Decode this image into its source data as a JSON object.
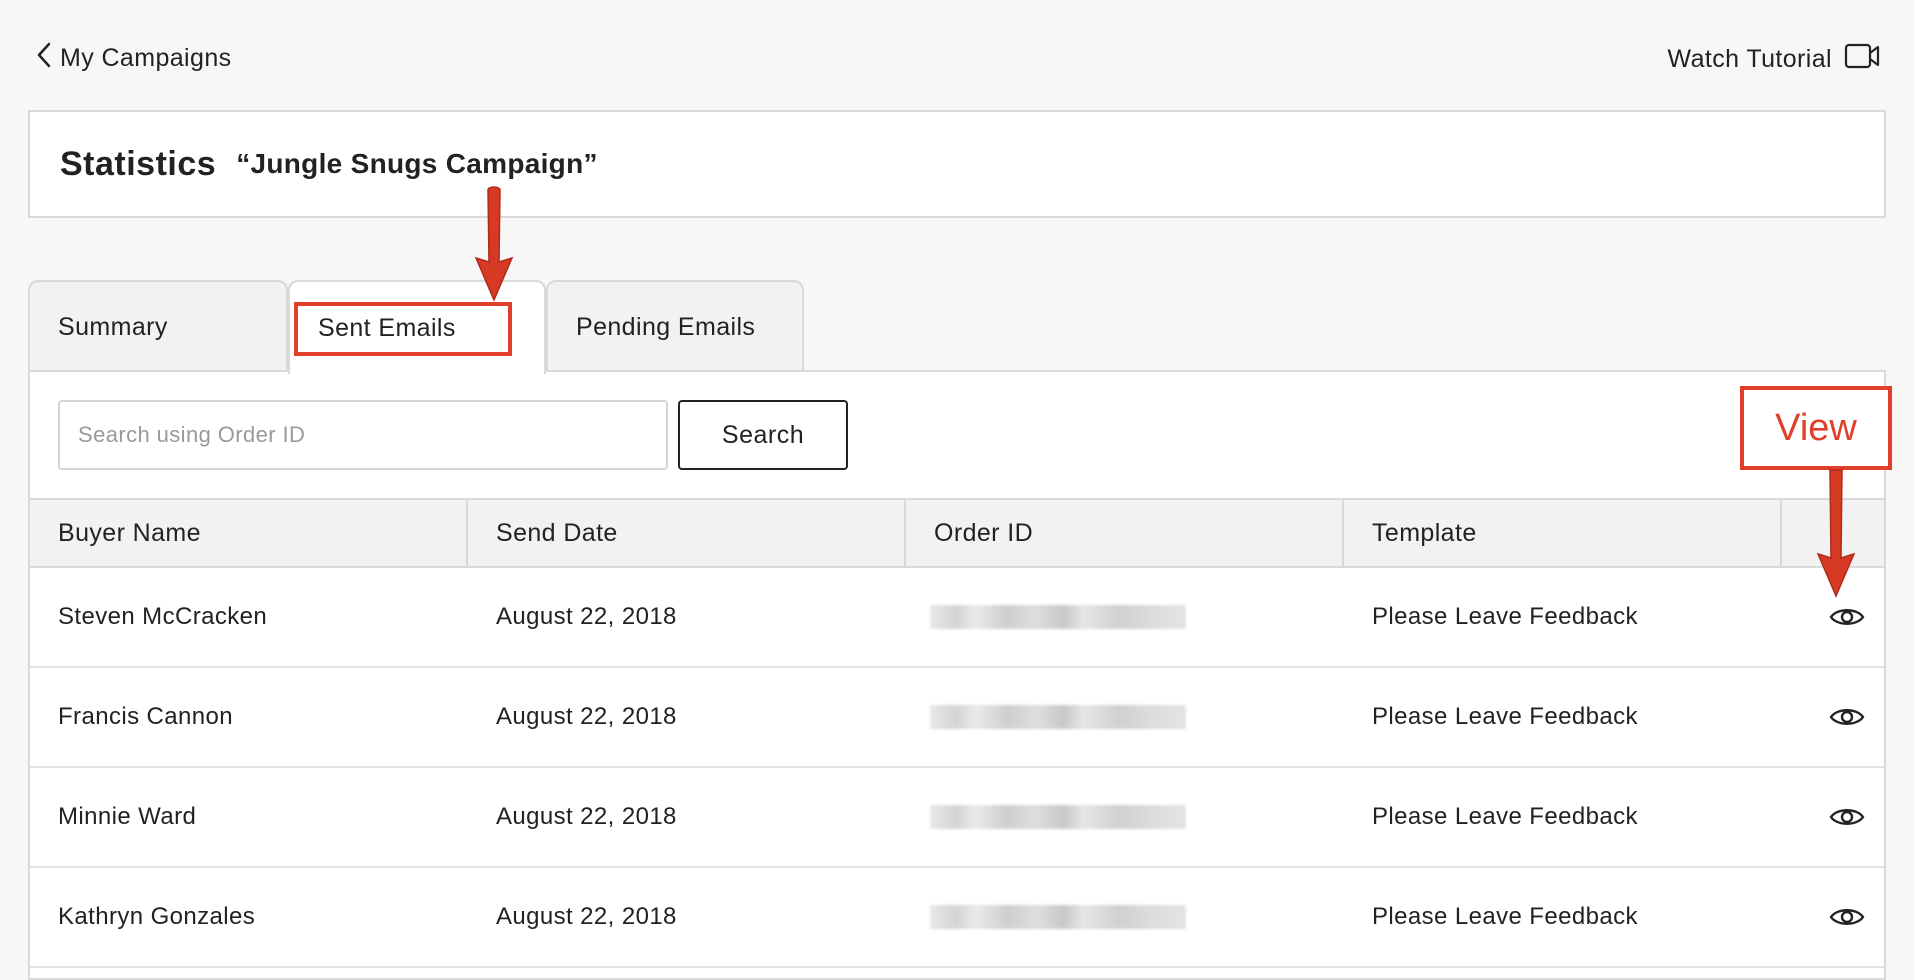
{
  "nav": {
    "back_label": "My Campaigns",
    "tutorial_label": "Watch Tutorial",
    "back_icon": "chevron-left-icon",
    "tutorial_icon": "video-camera-icon"
  },
  "header": {
    "title": "Statistics",
    "campaign_name": "“Jungle Snugs Campaign”"
  },
  "tabs": [
    {
      "label": "Summary",
      "active": false
    },
    {
      "label": "Sent Emails",
      "active": true
    },
    {
      "label": "Pending Emails",
      "active": false
    }
  ],
  "search": {
    "placeholder": "Search using Order ID",
    "value": "",
    "button_label": "Search"
  },
  "table": {
    "columns": [
      "Buyer Name",
      "Send Date",
      "Order ID",
      "Template",
      ""
    ],
    "rows": [
      {
        "buyer": "Steven McCracken",
        "date": "August 22, 2018",
        "template": "Please Leave Feedback"
      },
      {
        "buyer": "Francis Cannon",
        "date": "August 22, 2018",
        "template": "Please Leave Feedback"
      },
      {
        "buyer": "Minnie Ward",
        "date": "August 22, 2018",
        "template": "Please Leave Feedback"
      },
      {
        "buyer": "Kathryn Gonzales",
        "date": "August 22, 2018",
        "template": "Please Leave Feedback"
      }
    ],
    "action_icon": "eye-icon"
  },
  "annotations": {
    "view_label": "View",
    "color": "#e0402a"
  }
}
